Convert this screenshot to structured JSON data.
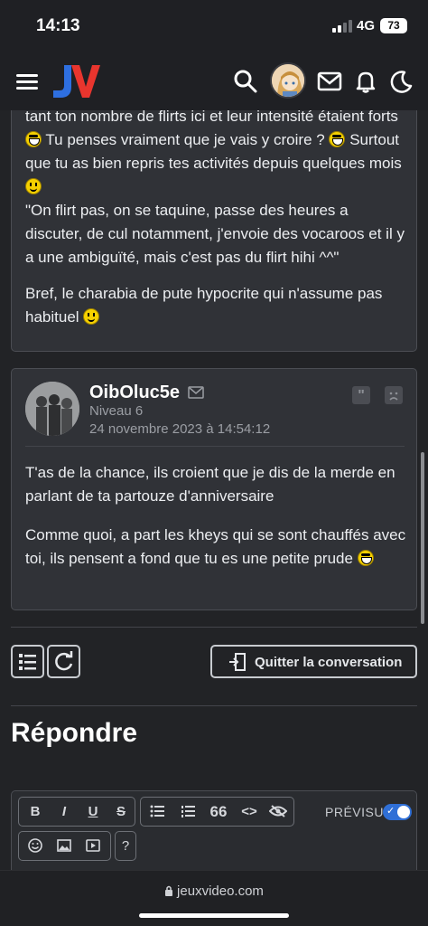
{
  "status": {
    "time": "14:13",
    "network": "4G",
    "battery": "73"
  },
  "site": {
    "logo": "JV",
    "url": "jeuxvideo.com"
  },
  "post1": {
    "text_a_1": "tant ton nombre de flirts ici et leur intensité étaient forts",
    "text_a_2": "Tu penses vraiment que je vais y croire ?",
    "text_a_3": "Surtout que tu as bien repris tes activités depuis quelques mois",
    "text_a_4": "\"On flirt pas, on se taquine, passe des heures a discuter, de cul notamment, j'envoie des vocaroos et il y a une ambiguïté, mais c'est pas du flirt hihi ^^\"",
    "text_b": "Bref, le charabia de pute hypocrite qui n'assume pas habituel"
  },
  "post2": {
    "author": "OibOluc5e",
    "level": "Niveau 6",
    "date": "24 novembre 2023 à 14:54:12",
    "quote_symbol": "\"",
    "text_a": "T'as de la chance, ils croient que je dis de la merde en parlant de ta partouze d'anniversaire",
    "text_b": "Comme quoi, a part les kheys qui se sont chauffés avec toi, ils pensent a fond que tu es une petite prude"
  },
  "actions": {
    "leave_label": "Quitter la conversation"
  },
  "reply": {
    "title": "Répondre",
    "preview_label": "PRÉVISU",
    "toolbar": {
      "bold": "B",
      "italic": "I",
      "underline": "U",
      "strike": "S",
      "quote": "66",
      "code": "<>",
      "help": "?"
    }
  },
  "colors": {
    "accent": "#2f6fd6",
    "logo_red": "#e8352e",
    "logo_blue": "#2e6fe0"
  }
}
